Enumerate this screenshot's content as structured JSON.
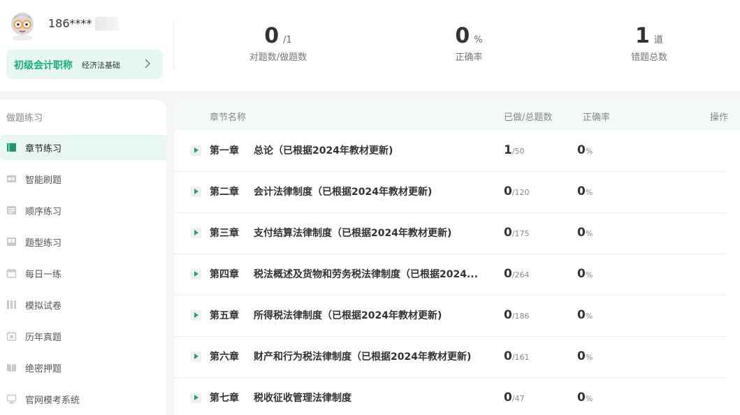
{
  "user": {
    "phone": "186****"
  },
  "course": {
    "title": "初级会计职称",
    "subject": "经济法基础"
  },
  "stats": [
    {
      "value": "0",
      "unit": "/1",
      "label": "对题数/做题数"
    },
    {
      "value": "0",
      "unit": "%",
      "label": "正确率"
    },
    {
      "value": "1",
      "unit": "道",
      "label": "错题总数"
    }
  ],
  "sidebar": {
    "heading": "做题练习",
    "items": [
      {
        "label": "章节练习",
        "icon": "book-icon",
        "active": true
      },
      {
        "label": "智能刷题",
        "icon": "smart-practice-icon"
      },
      {
        "label": "顺序练习",
        "icon": "list-icon"
      },
      {
        "label": "题型练习",
        "icon": "question-type-icon"
      },
      {
        "label": "每日一练",
        "icon": "calendar-icon"
      },
      {
        "label": "模拟试卷",
        "icon": "exam-paper-icon"
      },
      {
        "label": "历年真题",
        "icon": "past-exam-icon"
      },
      {
        "label": "绝密押题",
        "icon": "secret-book-icon"
      },
      {
        "label": "官网模考系统",
        "icon": "monitor-icon"
      }
    ]
  },
  "table": {
    "headers": {
      "name": "章节名称",
      "progress": "已做/总题数",
      "rate": "正确率",
      "action": "操作"
    },
    "rows": [
      {
        "chapter": "第一章",
        "title": "总论（已根据2024年教材更新)",
        "done": "1",
        "total": "/50",
        "rate": "0",
        "pct": "%"
      },
      {
        "chapter": "第二章",
        "title": "会计法律制度（已根据2024年教材更新)",
        "done": "0",
        "total": "/120",
        "rate": "0",
        "pct": "%"
      },
      {
        "chapter": "第三章",
        "title": "支付结算法律制度（已根据2024年教材更新)",
        "done": "0",
        "total": "/175",
        "rate": "0",
        "pct": "%"
      },
      {
        "chapter": "第四章",
        "title": "税法概述及货物和劳务税法律制度（已根据2024...",
        "done": "0",
        "total": "/264",
        "rate": "0",
        "pct": "%"
      },
      {
        "chapter": "第五章",
        "title": "所得税法律制度（已根据2024年教材更新)",
        "done": "0",
        "total": "/186",
        "rate": "0",
        "pct": "%"
      },
      {
        "chapter": "第六章",
        "title": "财产和行为税法律制度（已根据2024年教材更新)",
        "done": "0",
        "total": "/161",
        "rate": "0",
        "pct": "%"
      },
      {
        "chapter": "第七章",
        "title": "税收征收管理法律制度",
        "done": "0",
        "total": "/47",
        "rate": "0",
        "pct": "%"
      }
    ]
  },
  "colors": {
    "accent": "#1aaf7e",
    "active_bg": "#e8f7f1",
    "play": "#2a9d76"
  }
}
